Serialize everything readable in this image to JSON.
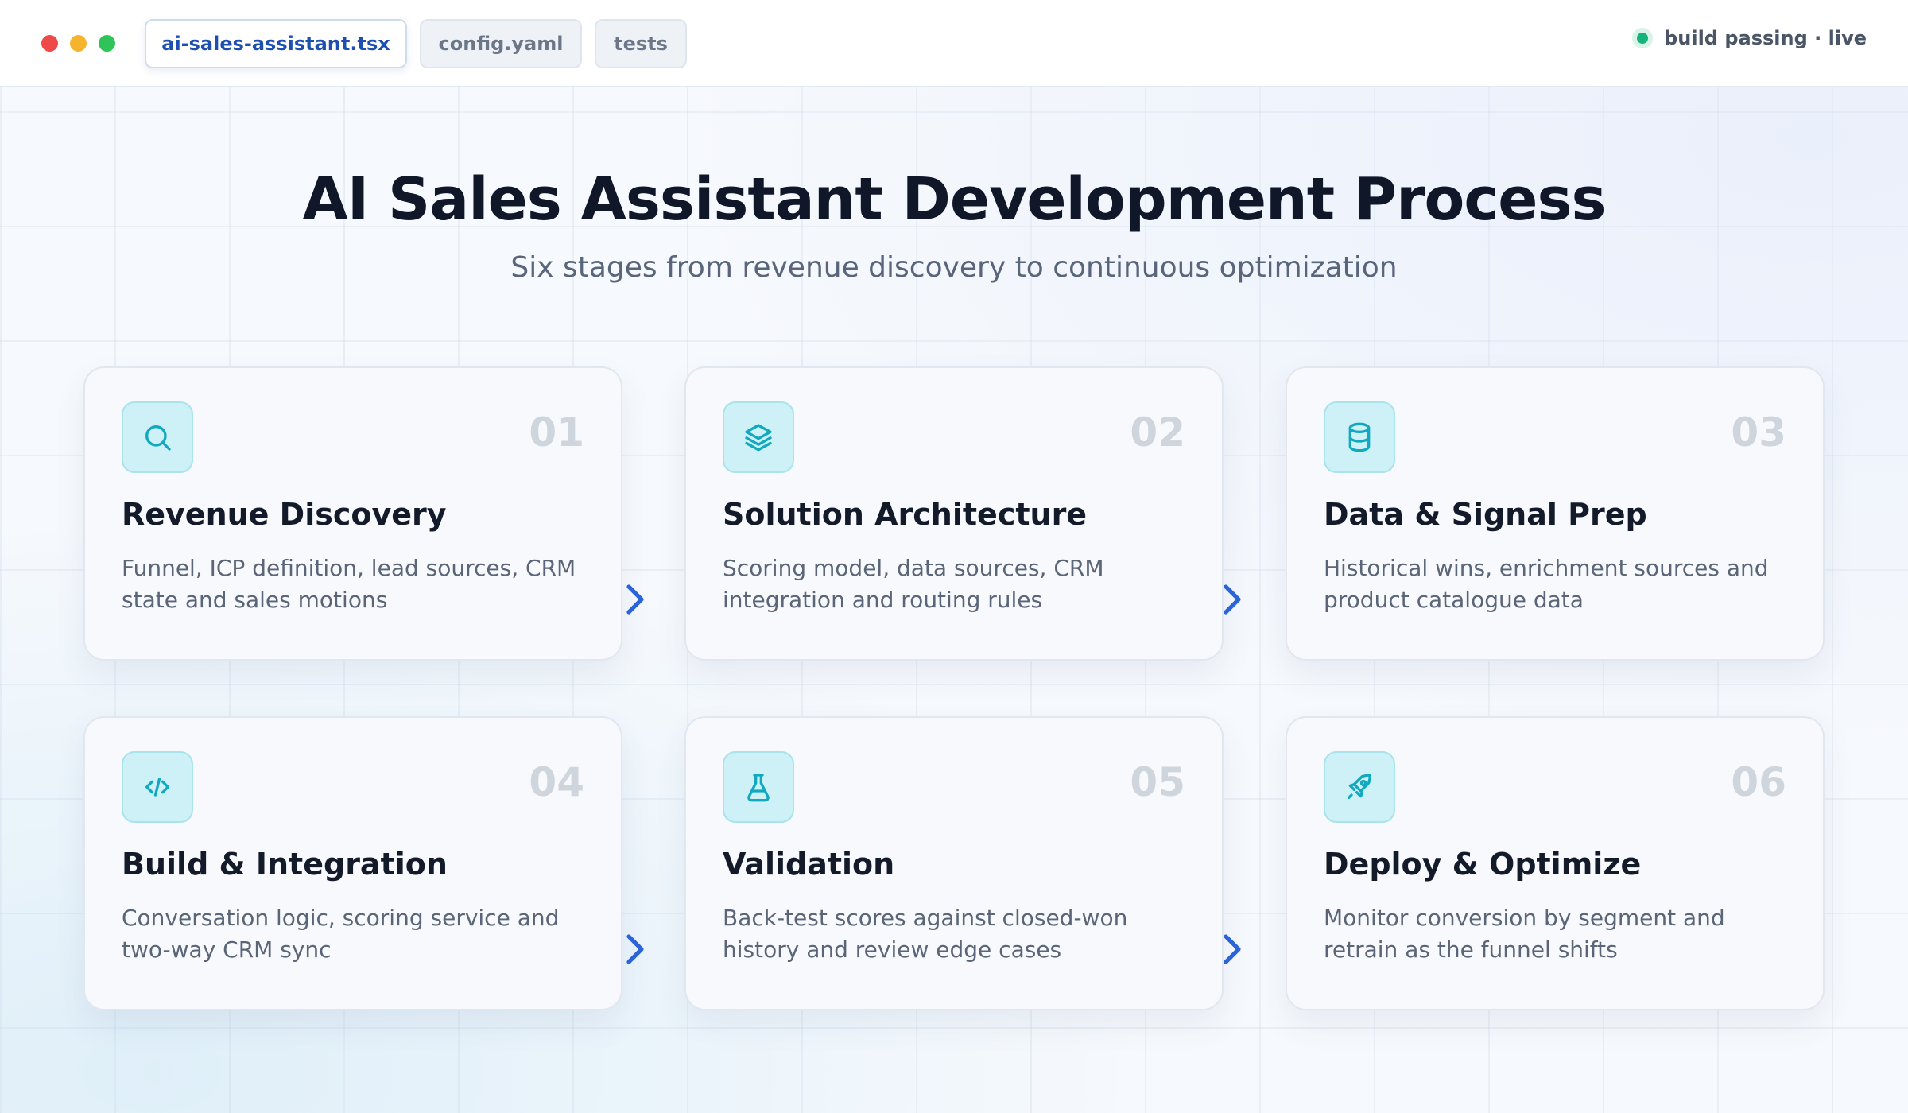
{
  "window": {
    "tabs": [
      {
        "label": "ai-sales-assistant.tsx",
        "active": true
      },
      {
        "label": "config.yaml",
        "active": false
      },
      {
        "label": "tests",
        "active": false
      }
    ],
    "status": "build passing · live"
  },
  "header": {
    "title": "AI Sales Assistant Development Process",
    "subtitle": "Six stages from revenue discovery to continuous optimization"
  },
  "colors": {
    "accent": "#1d4fb0",
    "icon": "#12a8bf",
    "icon_tile": "#cdf1f6",
    "status": "#14b37a",
    "arrow": "#2a64d6"
  },
  "stages": [
    {
      "number": "01",
      "title": "Revenue Discovery",
      "description": "Funnel, ICP definition, lead sources, CRM state and sales motions",
      "icon": "search-icon"
    },
    {
      "number": "02",
      "title": "Solution Architecture",
      "description": "Scoring model, data sources, CRM integration and routing rules",
      "icon": "layers-icon"
    },
    {
      "number": "03",
      "title": "Data & Signal Prep",
      "description": "Historical wins, enrichment sources and product catalogue data",
      "icon": "database-icon"
    },
    {
      "number": "04",
      "title": "Build & Integration",
      "description": "Conversation logic, scoring service and two-way CRM sync",
      "icon": "code-icon"
    },
    {
      "number": "05",
      "title": "Validation",
      "description": "Back-test scores against closed-won history and review edge cases",
      "icon": "flask-icon"
    },
    {
      "number": "06",
      "title": "Deploy & Optimize",
      "description": "Monitor conversion by segment and retrain as the funnel shifts",
      "icon": "rocket-icon"
    }
  ]
}
